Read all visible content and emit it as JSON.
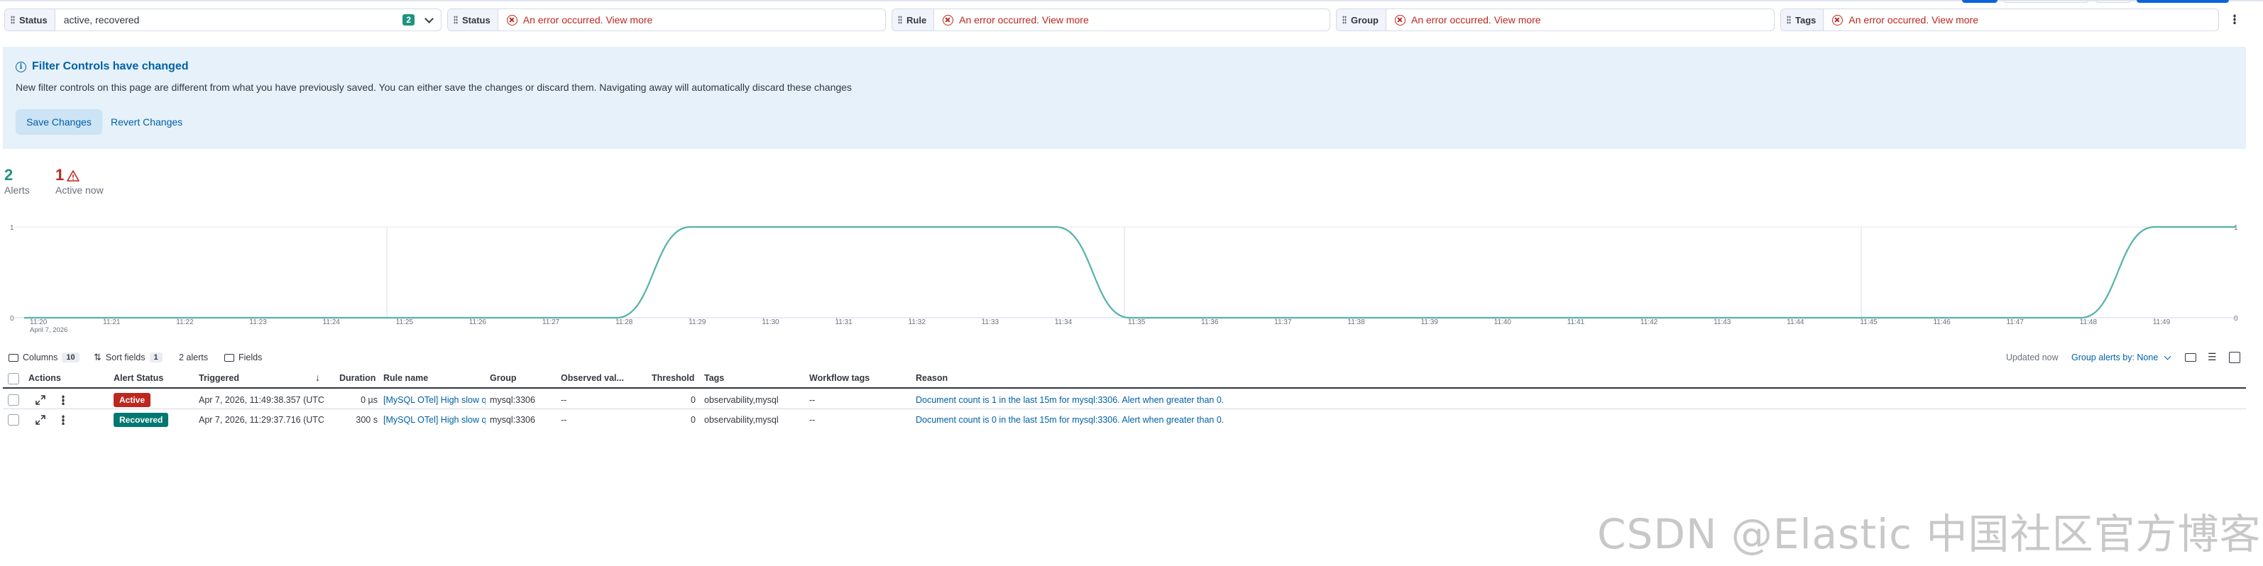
{
  "filters": [
    {
      "label": "Status",
      "value": "active, recovered",
      "count": "2",
      "error": false
    },
    {
      "label": "Status",
      "value": "An error occurred. View more",
      "error": true
    },
    {
      "label": "Rule",
      "value": "An error occurred. View more",
      "error": true
    },
    {
      "label": "Group",
      "value": "An error occurred. View more",
      "error": true
    },
    {
      "label": "Tags",
      "value": "An error occurred. View more",
      "error": true
    }
  ],
  "callout": {
    "title": "Filter Controls have changed",
    "body": "New filter controls on this page are different from what you have previously saved. You can either save the changes or discard them. Navigating away will automatically discard these changes",
    "save_label": "Save Changes",
    "revert_label": "Revert Changes"
  },
  "stats": {
    "alerts_count": "2",
    "alerts_label": "Alerts",
    "active_count": "1",
    "active_label": "Active now"
  },
  "chart_data": {
    "type": "area",
    "x": [
      "11:20",
      "11:21",
      "11:22",
      "11:23",
      "11:24",
      "11:25",
      "11:26",
      "11:27",
      "11:28",
      "11:29",
      "11:30",
      "11:31",
      "11:32",
      "11:33",
      "11:34",
      "11:35",
      "11:36",
      "11:37",
      "11:38",
      "11:39",
      "11:40",
      "11:41",
      "11:42",
      "11:43",
      "11:44",
      "11:45",
      "11:46",
      "11:47",
      "11:48",
      "11:49"
    ],
    "x_sub_label": "April 7, 2026",
    "series": [
      {
        "values": [
          0,
          0,
          0,
          0,
          0,
          0,
          0,
          0,
          0,
          1,
          1,
          1,
          1,
          1,
          1,
          0,
          0,
          0,
          0,
          0,
          0,
          0,
          0,
          0,
          0,
          0,
          0,
          0,
          0,
          1
        ]
      }
    ],
    "y_ticks": [
      "0",
      "1"
    ],
    "ylim": [
      0,
      1
    ],
    "color": "#54b3a8"
  },
  "toolbar": {
    "columns_label": "Columns",
    "columns_count": "10",
    "sort_label": "Sort fields",
    "sort_count": "1",
    "alerts_summary": "2 alerts",
    "fields_label": "Fields",
    "updated": "Updated now",
    "group_by": "Group alerts by: None"
  },
  "table": {
    "headers": [
      "Actions",
      "Alert Status",
      "Triggered",
      "Duration",
      "Rule name",
      "Group",
      "Observed val...",
      "Threshold",
      "Tags",
      "Workflow tags",
      "Reason"
    ],
    "rows": [
      {
        "status": "Active",
        "triggered": "Apr 7, 2026, 11:49:38.357 (UTC",
        "duration": "0 µs",
        "rule": "[MySQL OTel] High slow q",
        "group": "mysql:3306",
        "observed": "--",
        "threshold": "0",
        "tags": "observability,mysql",
        "workflow": "--",
        "reason": "Document count is 1 in the last 15m for mysql:3306. Alert when greater than 0."
      },
      {
        "status": "Recovered",
        "triggered": "Apr 7, 2026, 11:29:37.716 (UTC",
        "duration": "300 s",
        "rule": "[MySQL OTel] High slow q",
        "group": "mysql:3306",
        "observed": "--",
        "threshold": "0",
        "tags": "observability,mysql",
        "workflow": "--",
        "reason": "Document count is 0 in the last 15m for mysql:3306. Alert when greater than 0."
      }
    ]
  },
  "watermark": "CSDN @Elastic 中国社区官方博客",
  "colors": {
    "accent": "#0061a6",
    "active": "#bd271e",
    "recovered": "#007871",
    "series": "#54b3a8"
  }
}
